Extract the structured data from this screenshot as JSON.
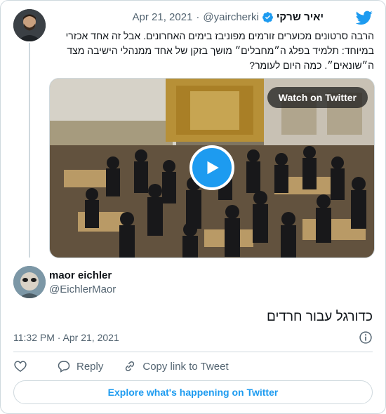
{
  "parent_tweet": {
    "author_name": "יאיר שרקי",
    "handle": "@yaircherki",
    "separator": "·",
    "date": "Apr 21, 2021",
    "text": "הרבה סרטונים מכוערים זורמים מפוניבז בימים האחרונים. אבל זה אחד אכזרי במיוחד: תלמיד בפלג ה״מחבלים״ מושך בזקן של אחד ממנהלי הישיבה מצד ה״שונאים״. כמה היום לעומר?",
    "media": {
      "watch_label": "Watch on Twitter"
    }
  },
  "tweet": {
    "author_name": "maor eichler",
    "handle": "@EichlerMaor",
    "text": "כדורגל עבור חרדים",
    "timestamp": "11:32 PM · Apr 21, 2021"
  },
  "actions": {
    "reply_label": "Reply",
    "copy_link_label": "Copy link to Tweet"
  },
  "explore_label": "Explore what's happening on Twitter",
  "icons": {
    "brand": "twitter-bird-icon",
    "verified": "verified-badge-icon",
    "play": "play-icon",
    "info": "info-icon",
    "like": "heart-icon",
    "reply": "reply-bubble-icon",
    "copy": "link-icon"
  },
  "colors": {
    "brand_blue": "#1d9bf0",
    "text": "#0f1419",
    "muted": "#536471",
    "border": "#cfd9de"
  }
}
